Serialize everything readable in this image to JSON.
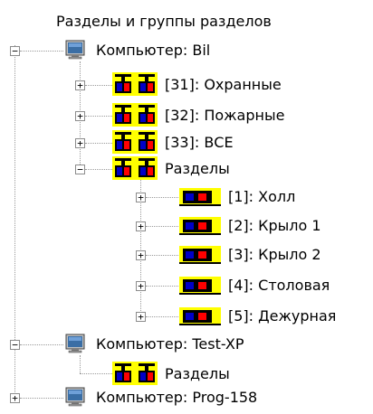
{
  "tree": {
    "root_label": "Разделы и группы разделов",
    "nodes": [
      {
        "label": "Компьютер: Bil",
        "icon": "computer-icon",
        "expanded": true
      },
      {
        "label": "[31]: Охранные",
        "icon": "partition-group-icon",
        "expanded": false
      },
      {
        "label": "[32]: Пожарные",
        "icon": "partition-group-icon",
        "expanded": false
      },
      {
        "label": "[33]: ВСЕ",
        "icon": "partition-group-icon",
        "expanded": false
      },
      {
        "label": "Разделы",
        "icon": "partition-group-icon",
        "expanded": true
      },
      {
        "label": "[1]: Холл",
        "icon": "partition-icon",
        "expanded": false
      },
      {
        "label": "[2]: Крыло 1",
        "icon": "partition-icon",
        "expanded": false
      },
      {
        "label": "[3]: Крыло 2",
        "icon": "partition-icon",
        "expanded": false
      },
      {
        "label": "[4]: Столовая",
        "icon": "partition-icon",
        "expanded": false
      },
      {
        "label": "[5]: Дежурная",
        "icon": "partition-icon",
        "expanded": false
      },
      {
        "label": "Компьютер: Test-XP",
        "icon": "computer-icon",
        "expanded": true
      },
      {
        "label": "Разделы",
        "icon": "partition-group-icon",
        "expanded": false
      },
      {
        "label": "Компьютер: Prog-158",
        "icon": "computer-icon",
        "expanded": false
      }
    ],
    "expander": {
      "collapsed": "+",
      "expanded": "−"
    }
  },
  "colors": {
    "icon_yellow": "#ffff00",
    "icon_red": "#ff0000",
    "icon_blue": "#0000c8",
    "tree_line": "#9a9a9a"
  }
}
